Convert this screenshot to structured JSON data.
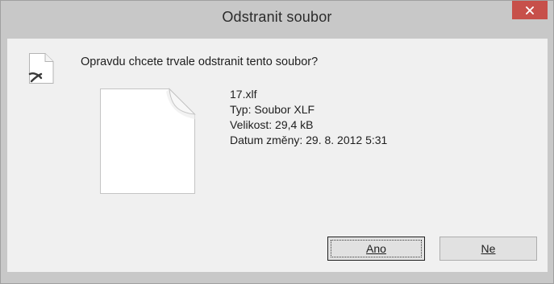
{
  "dialog": {
    "title": "Odstranit soubor",
    "question": "Opravdu chcete trvale odstranit tento soubor?"
  },
  "file": {
    "name": "17.xlf",
    "type": "Typ: Soubor XLF",
    "size": "Velikost: 29,4 kB",
    "modified": "Datum změny: 29. 8. 2012 5:31"
  },
  "buttons": {
    "yes_label": "Ano",
    "no_label": "Ne"
  },
  "colors": {
    "close_button": "#c7504a",
    "window_frame": "#c8c8c8",
    "client_background": "#f0f0f0"
  },
  "icons": {
    "close": "close-icon",
    "delete_file": "delete-file-icon",
    "file": "file-icon"
  }
}
